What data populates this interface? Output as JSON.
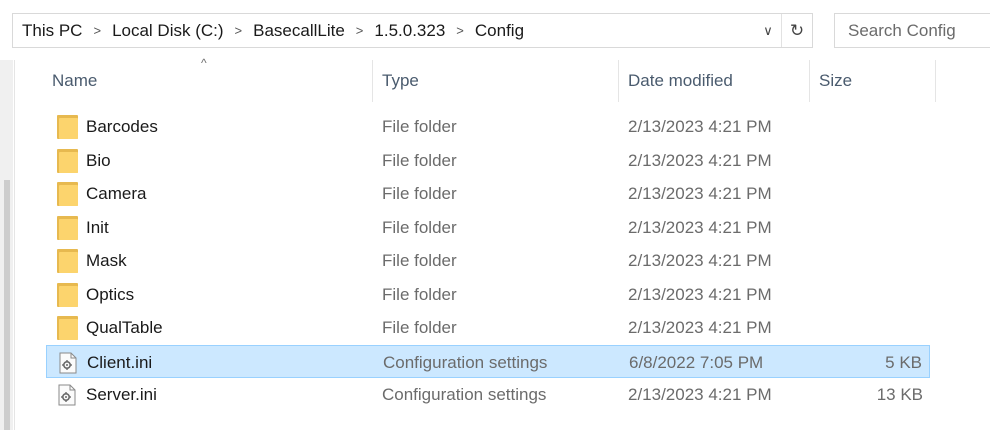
{
  "address": {
    "crumbs": [
      "This PC",
      "Local Disk (C:)",
      "BasecallLite",
      "1.5.0.323",
      "Config"
    ],
    "separator": ">",
    "dropdown_glyph": "∨",
    "refresh_glyph": "↻"
  },
  "search": {
    "placeholder": "Search Config"
  },
  "columns": {
    "name": "Name",
    "type": "Type",
    "date": "Date modified",
    "size": "Size"
  },
  "sort_glyph": "^",
  "files": [
    {
      "name": "Barcodes",
      "type": "File folder",
      "date": "2/13/2023 4:21 PM",
      "size": "",
      "icon": "folder-icon",
      "selected": false
    },
    {
      "name": "Bio",
      "type": "File folder",
      "date": "2/13/2023 4:21 PM",
      "size": "",
      "icon": "folder-icon",
      "selected": false
    },
    {
      "name": "Camera",
      "type": "File folder",
      "date": "2/13/2023 4:21 PM",
      "size": "",
      "icon": "folder-icon",
      "selected": false
    },
    {
      "name": "Init",
      "type": "File folder",
      "date": "2/13/2023 4:21 PM",
      "size": "",
      "icon": "folder-icon",
      "selected": false
    },
    {
      "name": "Mask",
      "type": "File folder",
      "date": "2/13/2023 4:21 PM",
      "size": "",
      "icon": "folder-icon",
      "selected": false
    },
    {
      "name": "Optics",
      "type": "File folder",
      "date": "2/13/2023 4:21 PM",
      "size": "",
      "icon": "folder-icon",
      "selected": false
    },
    {
      "name": "QualTable",
      "type": "File folder",
      "date": "2/13/2023 4:21 PM",
      "size": "",
      "icon": "folder-icon",
      "selected": false
    },
    {
      "name": "Client.ini",
      "type": "Configuration settings",
      "date": "6/8/2022 7:05 PM",
      "size": "5 KB",
      "icon": "settings-file-icon",
      "selected": true
    },
    {
      "name": "Server.ini",
      "type": "Configuration settings",
      "date": "2/13/2023 4:21 PM",
      "size": "13 KB",
      "icon": "settings-file-icon",
      "selected": false
    }
  ],
  "colors": {
    "selection_bg": "#cce8ff",
    "selection_border": "#99d1ff",
    "folder": "#fcd46d",
    "header_text": "#4a5b6e"
  }
}
